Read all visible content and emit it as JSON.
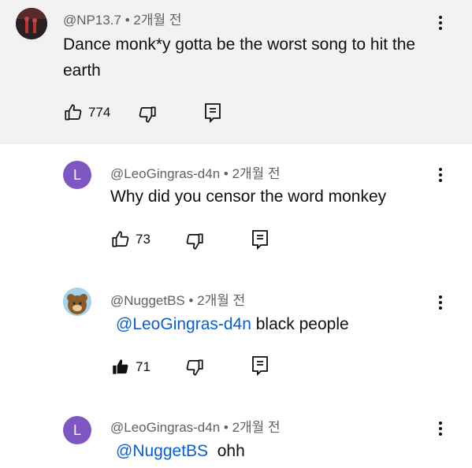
{
  "comments": [
    {
      "author": "@NP13.7",
      "time": "2개월 전",
      "text": "Dance monk*y gotta be the worst song to hit the earth",
      "likes": "774"
    },
    {
      "avatar_letter": "L",
      "author": "@LeoGingras-d4n",
      "time": "2개월 전",
      "text": "Why did you censor the word monkey",
      "likes": "73"
    },
    {
      "author": "@NuggetBS",
      "time": "2개월 전",
      "mention": "@LeoGingras-d4n",
      "text": " black people",
      "likes": "71"
    },
    {
      "avatar_letter": "L",
      "author": "@LeoGingras-d4n",
      "time": "2개월 전",
      "mention": "@NuggetBS",
      "text": "  ohh"
    }
  ],
  "separator": " • "
}
